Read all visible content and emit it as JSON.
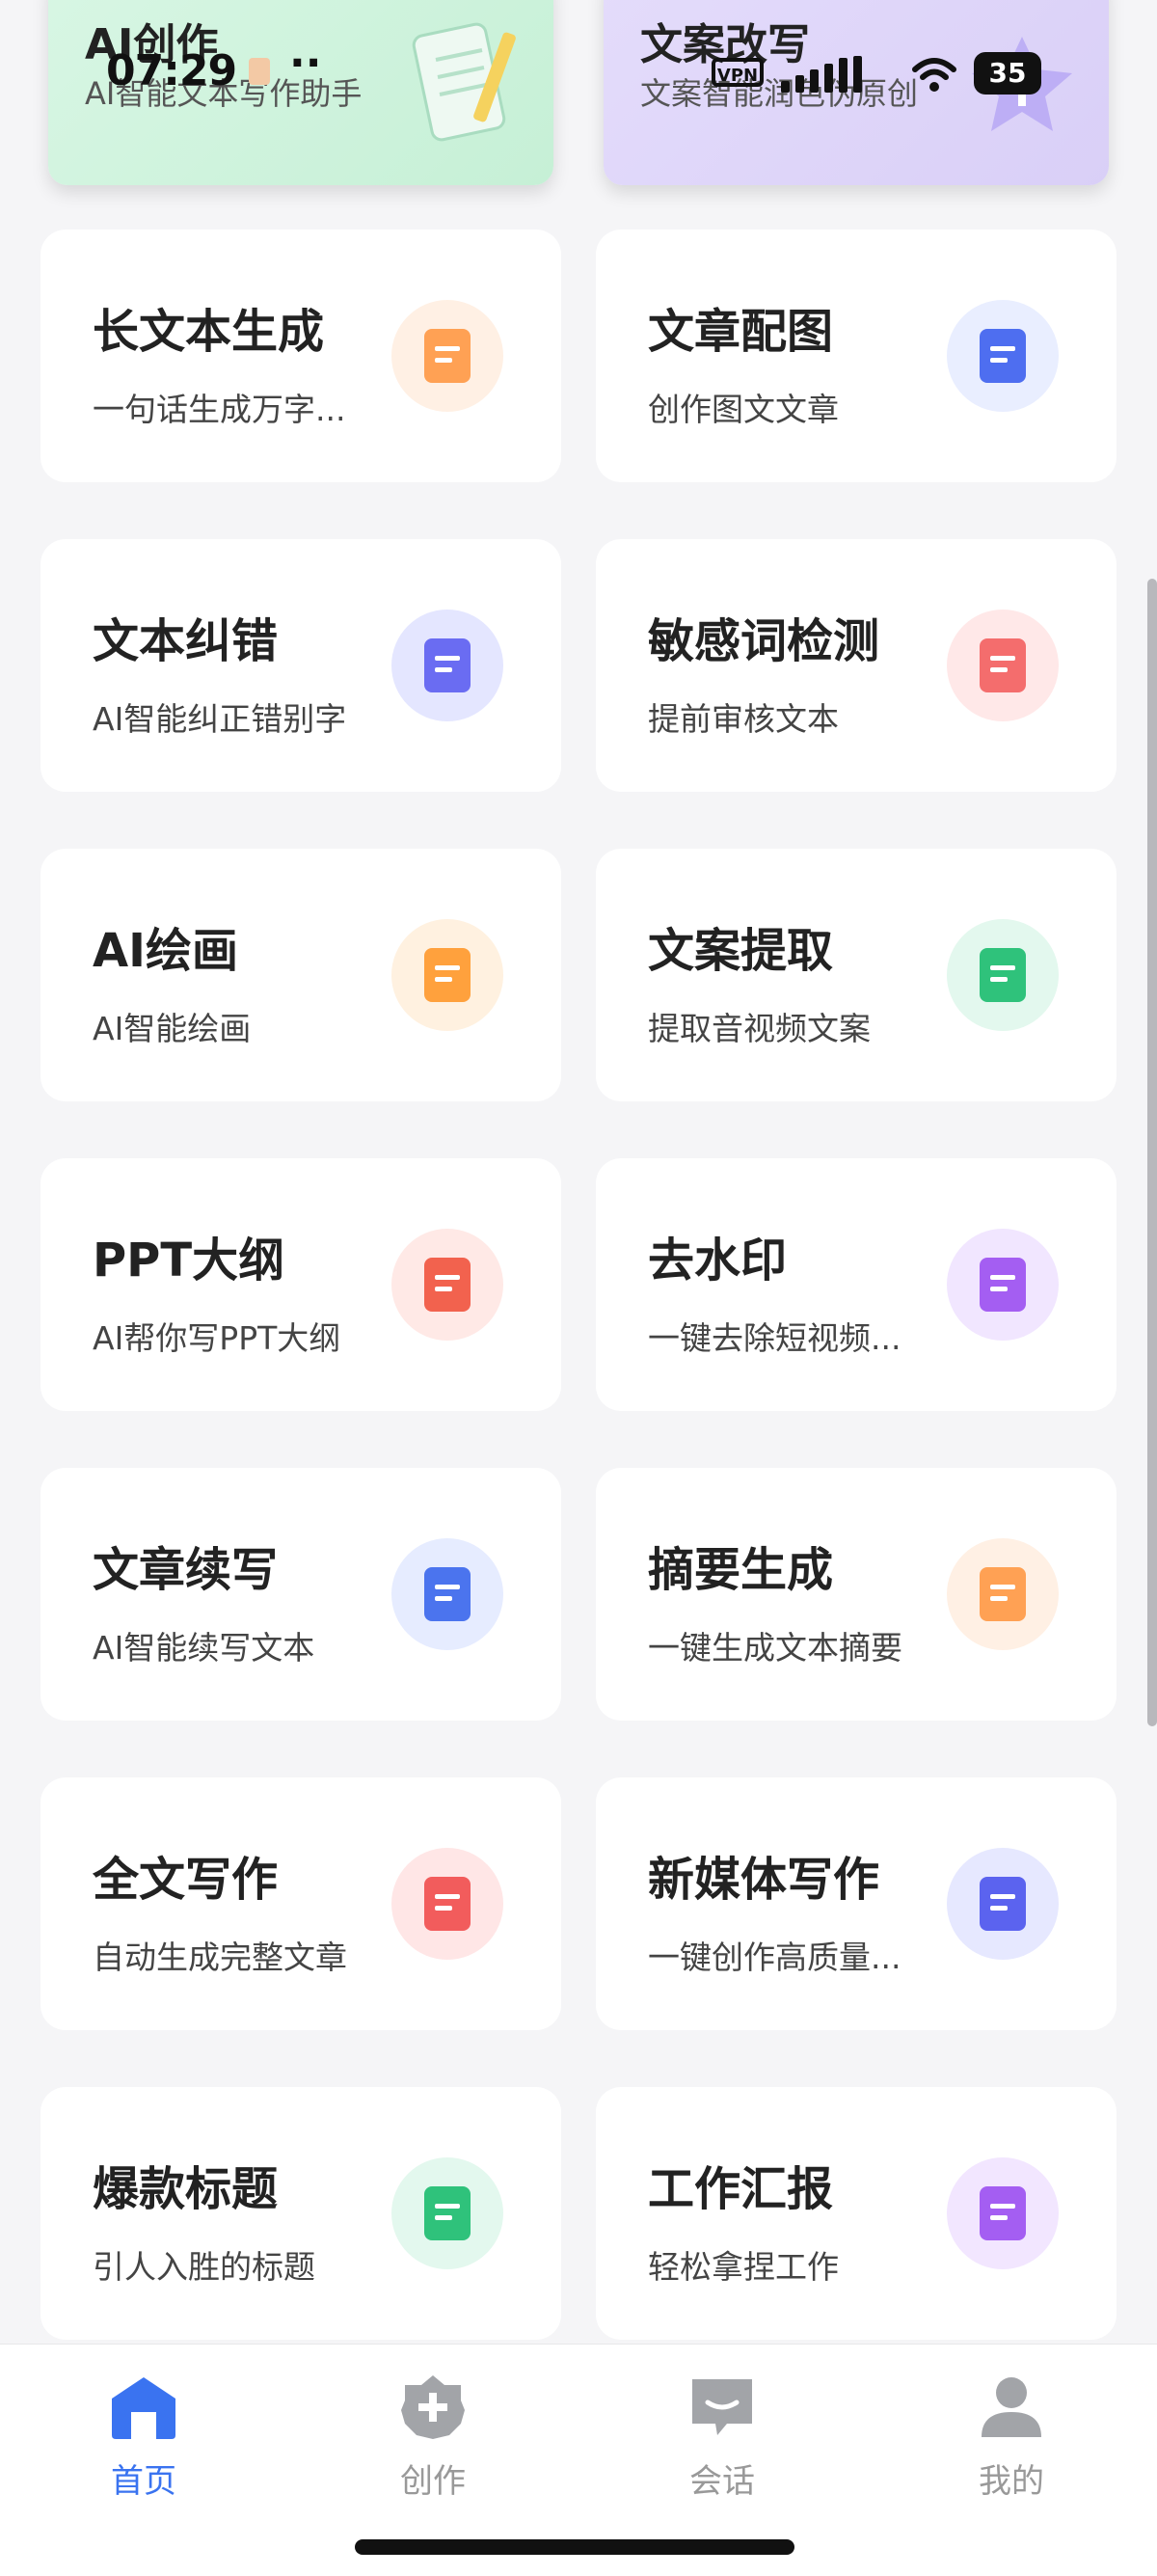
{
  "status_bar": {
    "time": "07:29",
    "dots": "··",
    "vpn": "VPN",
    "battery": "35"
  },
  "promos": [
    {
      "title": "AI创作",
      "subtitle": "AI智能文本写作助手"
    },
    {
      "title": "文案改写",
      "subtitle": "文案智能润色伪原创"
    }
  ],
  "cards": [
    {
      "title": "长文本生成",
      "subtitle": "一句话生成万字...",
      "icon": "document-icon",
      "bg": "#fff0e4",
      "color": "#ffa154"
    },
    {
      "title": "文章配图",
      "subtitle": "创作图文文章",
      "icon": "image-icon",
      "bg": "#e9eeff",
      "color": "#4e6ef0"
    },
    {
      "title": "文本纠错",
      "subtitle": "AI智能纠正错别字",
      "icon": "edit-document-icon",
      "bg": "#e4e6ff",
      "color": "#6a6cf2"
    },
    {
      "title": "敏感词检测",
      "subtitle": "提前审核文本",
      "icon": "search-document-icon",
      "bg": "#ffe8e8",
      "color": "#f46d6d"
    },
    {
      "title": "AI绘画",
      "subtitle": "AI智能绘画",
      "icon": "palette-icon",
      "bg": "#fff1e0",
      "color": "#ffa13d"
    },
    {
      "title": "文案提取",
      "subtitle": "提取音视频文案",
      "icon": "text-extract-icon",
      "bg": "#e3f8ee",
      "color": "#2fc27b"
    },
    {
      "title": "PPT大纲",
      "subtitle": "AI帮你写PPT大纲",
      "icon": "ppt-icon",
      "bg": "#ffe9e6",
      "color": "#f2624e"
    },
    {
      "title": "去水印",
      "subtitle": "一键去除短视频...",
      "icon": "watermark-icon",
      "bg": "#f1e6ff",
      "color": "#a45ef2"
    },
    {
      "title": "文章续写",
      "subtitle": "AI智能续写文本",
      "icon": "continue-writing-icon",
      "bg": "#e6ecff",
      "color": "#4b74ee"
    },
    {
      "title": "摘要生成",
      "subtitle": "一键生成文本摘要",
      "icon": "summary-icon",
      "bg": "#fff0e4",
      "color": "#ffa154"
    },
    {
      "title": "全文写作",
      "subtitle": "自动生成完整文章",
      "icon": "pencil-icon",
      "bg": "#ffe6e6",
      "color": "#f25c5c"
    },
    {
      "title": "新媒体写作",
      "subtitle": "一键创作高质量...",
      "icon": "video-icon",
      "bg": "#e6e8ff",
      "color": "#5b63ef"
    },
    {
      "title": "爆款标题",
      "subtitle": "引人入胜的标题",
      "icon": "title-icon",
      "bg": "#e3f8ee",
      "color": "#2fc27b"
    },
    {
      "title": "工作汇报",
      "subtitle": "轻松拿捏工作",
      "icon": "report-icon",
      "bg": "#f2e6ff",
      "color": "#a45ef2"
    }
  ],
  "tabs": [
    {
      "label": "首页",
      "icon": "home-icon",
      "active": true
    },
    {
      "label": "创作",
      "icon": "create-icon",
      "active": false
    },
    {
      "label": "会话",
      "icon": "chat-icon",
      "active": false
    },
    {
      "label": "我的",
      "icon": "profile-icon",
      "active": false
    }
  ],
  "colors": {
    "accent": "#3a73f0",
    "inactive": "#999999",
    "background": "#f5f5f7"
  }
}
